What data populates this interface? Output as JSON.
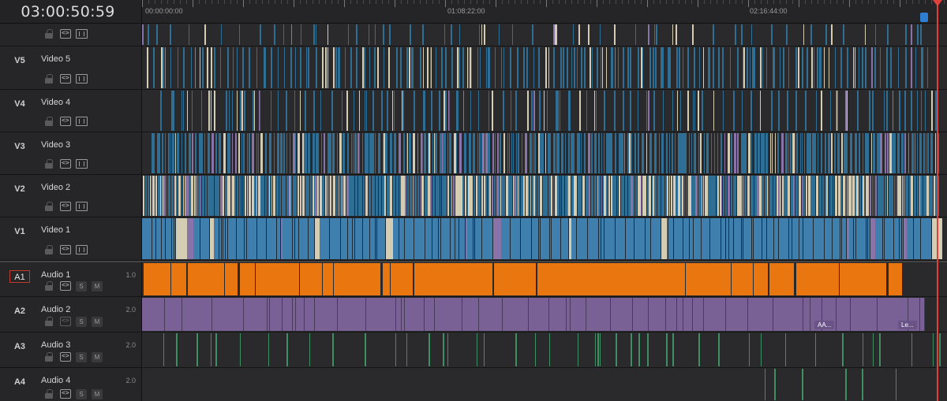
{
  "timecode": "03:00:50:59",
  "ruler": {
    "labels": [
      "00:00:00:00",
      "01:08:22:00",
      "02:16:44:00"
    ]
  },
  "tracks": [
    {
      "id": "V5",
      "name": "Video 5"
    },
    {
      "id": "V4",
      "name": "Video 4"
    },
    {
      "id": "V3",
      "name": "Video 3"
    },
    {
      "id": "V2",
      "name": "Video 2"
    },
    {
      "id": "V1",
      "name": "Video 1"
    },
    {
      "id": "A1",
      "name": "Audio 1",
      "level": "1.0"
    },
    {
      "id": "A2",
      "name": "Audio 2",
      "level": "2.0"
    },
    {
      "id": "A3",
      "name": "Audio 3",
      "level": "2.0"
    },
    {
      "id": "A4",
      "name": "Audio 4",
      "level": "2.0"
    }
  ],
  "buttons": {
    "solo": "S",
    "mute": "M"
  },
  "clip_labels": [
    "AA...",
    "Le..."
  ],
  "icons": [
    "lock-icon",
    "auto-track-icon",
    "video-toggle-icon",
    "playhead-icon",
    "marker-icon"
  ],
  "colors": {
    "video_clip": "#2f6f96",
    "v1_clip": "#3e7fae",
    "audio1_clip": "#e9760f",
    "audio2_clip": "#7a6195",
    "audio3_clip": "#3f8f63",
    "playhead": "#e0413a",
    "marker": "#2d7fd3"
  }
}
